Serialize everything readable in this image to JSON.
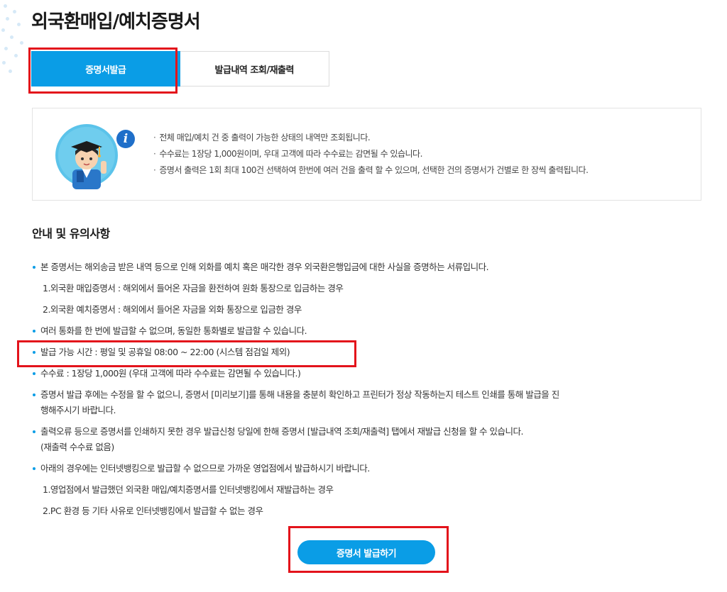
{
  "page": {
    "title": "외국환매입/예치증명서"
  },
  "tabs": [
    {
      "label": "증명서발급",
      "active": true
    },
    {
      "label": "발급내역 조회/재출력",
      "active": false
    }
  ],
  "info": {
    "icon": "info-icon",
    "items": [
      "전체 매입/예치 건 중 출력이 가능한 상태의 내역만 조회됩니다.",
      "수수료는 1장당 1,000원이며, 우대 고객에 따라 수수료는 감면될 수 있습니다.",
      "증명서 출력은 1회 최대 100건 선택하여 한번에 여러 건을 출력 할 수 있으며, 선택한 건의 증명서가 건별로 한 장씩 출력됩니다."
    ]
  },
  "notice": {
    "title": "안내 및 유의사항",
    "lines": [
      {
        "type": "bullet",
        "text": "본 증명서는 해외송금 받은 내역 등으로 인해 외화를 예치 혹은 매각한 경우 외국환은행입금에 대한 사실을 증명하는 서류입니다."
      },
      {
        "type": "sub",
        "text": "1.외국환 매입증명서 : 해외에서 들어온 자금을 환전하여 원화 통장으로 입금하는 경우"
      },
      {
        "type": "sub",
        "text": "2.외국환 예치증명서 : 해외에서 들어온 자금을 외화 통장으로 입금한 경우"
      },
      {
        "type": "bullet",
        "text": "여러 통화를 한 번에 발급할 수 없으며, 동일한 통화별로 발급할 수 있습니다."
      },
      {
        "type": "bullet",
        "text": "발급 가능 시간 : 평일 및 공휴일 08:00 ~ 22:00 (시스템 점검일 제외)"
      },
      {
        "type": "bullet",
        "text": "수수료 : 1장당 1,000원 (우대 고객에 따라 수수료는 감면될 수 있습니다.)"
      },
      {
        "type": "bullet",
        "text": "증명서 발급 후에는 수정을 할 수 없으니, 증명서 [미리보기]를 통해 내용을 충분히 확인하고 프린터가 정상 작동하는지 테스트 인쇄를 통해 발급을 진"
      },
      {
        "type": "cont",
        "text": "행해주시기 바랍니다."
      },
      {
        "type": "bullet",
        "text": "출력오류 등으로 증명서를 인쇄하지 못한 경우 발급신청 당일에 한해 증명서 [발급내역 조회/재출력] 탭에서 재발급 신청을 할 수 있습니다."
      },
      {
        "type": "cont",
        "text": "(재출력 수수료 없음)"
      },
      {
        "type": "bullet",
        "text": "아래의 경우에는 인터넷뱅킹으로 발급할 수 없으므로 가까운 영업점에서 발급하시기 바랍니다."
      },
      {
        "type": "sub",
        "text": "1.영업점에서 발급했던 외국환 매입/예치증명서를 인터넷뱅킹에서 재발급하는 경우"
      },
      {
        "type": "sub",
        "text": "2.PC 환경 등 기타 사유로 인터넷뱅킹에서 발급할 수 없는 경우"
      }
    ]
  },
  "cta": {
    "label": "증명서 발급하기"
  },
  "colors": {
    "accent": "#0a9de6",
    "highlight": "#e3131b"
  }
}
